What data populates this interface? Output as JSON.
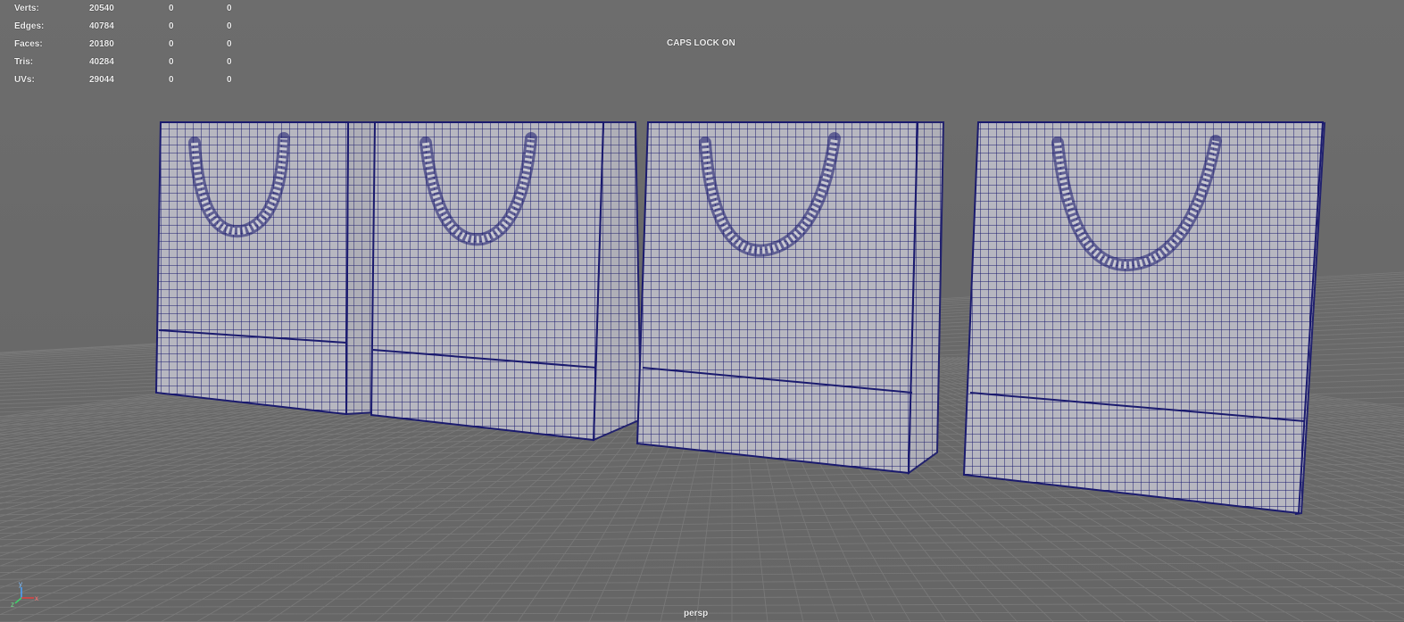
{
  "viewport": {
    "camera": "persp",
    "status_message": "CAPS LOCK ON"
  },
  "hud": {
    "rows": [
      {
        "label": "Verts:",
        "values": [
          "20540",
          "0",
          "0"
        ]
      },
      {
        "label": "Edges:",
        "values": [
          "40784",
          "0",
          "0"
        ]
      },
      {
        "label": "Faces:",
        "values": [
          "20180",
          "0",
          "0"
        ]
      },
      {
        "label": "Tris:",
        "values": [
          "40284",
          "0",
          "0"
        ]
      },
      {
        "label": "UVs:",
        "values": [
          "29044",
          "0",
          "0"
        ]
      }
    ]
  },
  "axis_gizmo": {
    "x_label": "x",
    "y_label": "y",
    "z_label": "z"
  },
  "colors": {
    "background": "#6b6b6b",
    "grid": "#7a7a7a",
    "wireframe": "#1a1a6e",
    "mesh_fill": "#b9b9c2",
    "hud_text": "#f2f2f2"
  },
  "scene": {
    "objects": [
      {
        "name": "shopping-bag-1",
        "type": "mesh"
      },
      {
        "name": "shopping-bag-2",
        "type": "mesh"
      },
      {
        "name": "shopping-bag-3",
        "type": "mesh"
      },
      {
        "name": "shopping-bag-4",
        "type": "mesh"
      }
    ]
  }
}
